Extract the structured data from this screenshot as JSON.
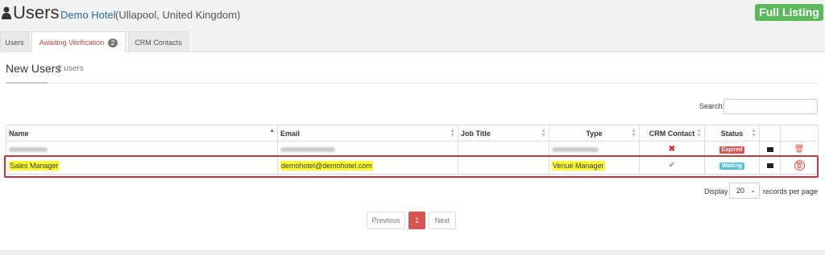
{
  "header": {
    "title": "Users",
    "hotel_name": "Demo Hotel",
    "hotel_location": "(Ullapool, United Kingdom)",
    "full_listing_label": "Full Listing"
  },
  "tabs": [
    {
      "label": "Users"
    },
    {
      "label": "Awaiting Verification",
      "badge": "2"
    },
    {
      "label": "CRM Contacts"
    }
  ],
  "section": {
    "title": "New Users",
    "count": "2 users"
  },
  "search": {
    "label": "Search:",
    "value": ""
  },
  "table": {
    "columns": [
      "Name",
      "Email",
      "Job Title",
      "Type",
      "CRM Contact",
      "Status"
    ],
    "rows": [
      {
        "name": "",
        "email": "",
        "job_title": "",
        "type": "",
        "crm_contact": "✖",
        "status": "Expired"
      },
      {
        "name": "Sales Manager",
        "email": "demohotel@demohotel.com",
        "job_title": "",
        "type": "Venue Manager",
        "crm_contact": "✔",
        "status": "Waiting"
      }
    ]
  },
  "length": {
    "display_label": "Display",
    "selected": "20",
    "records_label": "records per page"
  },
  "pagination": {
    "previous": "Previous",
    "current": "1",
    "next": "Next"
  },
  "colors": {
    "accent_red": "#d9534f",
    "success_green": "#5cb85c",
    "info_blue": "#5bc0de",
    "link_blue": "#2a6aa8",
    "highlight_yellow": "#ffff33"
  },
  "icons": {
    "user": "user-icon",
    "mail": "envelope-icon",
    "delete": "trash-icon"
  }
}
